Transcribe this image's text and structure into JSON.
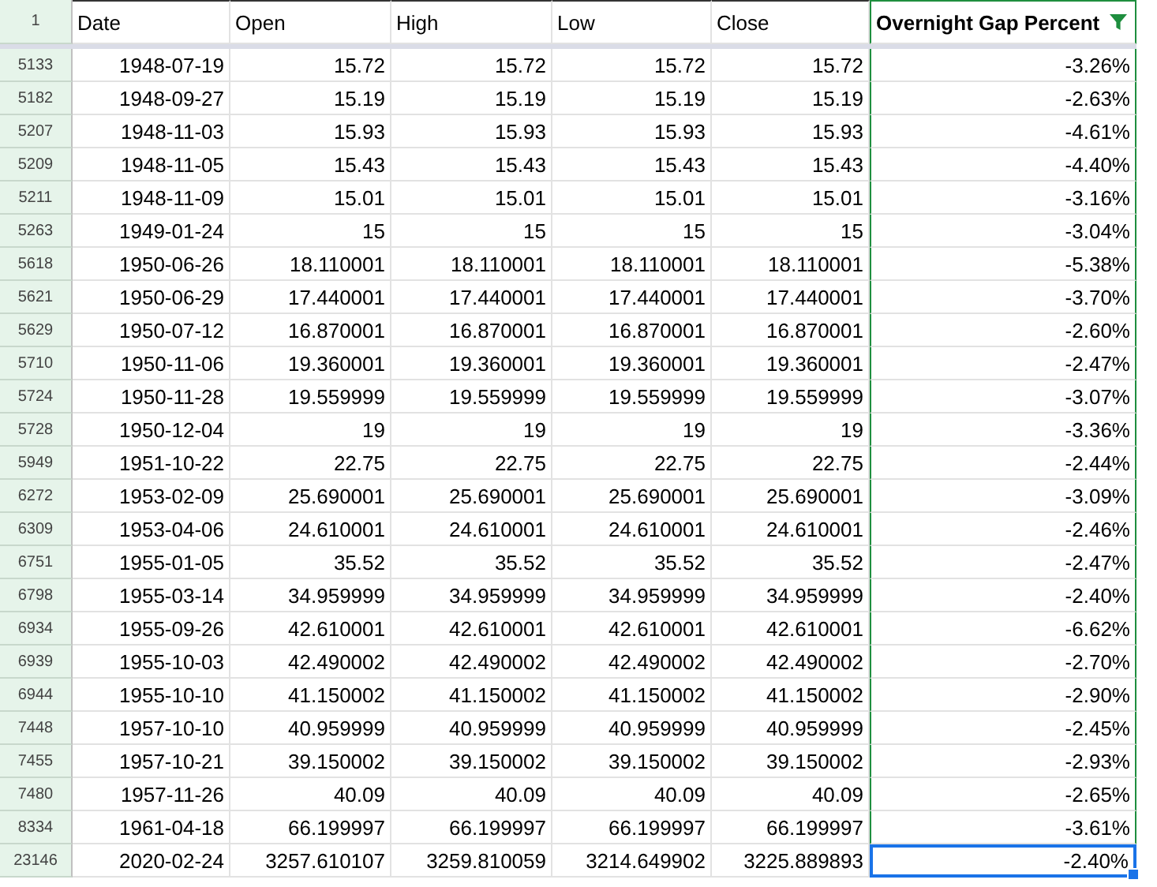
{
  "corner": "1",
  "columns": [
    {
      "label": "Date",
      "filtered": false
    },
    {
      "label": "Open",
      "filtered": false
    },
    {
      "label": "High",
      "filtered": false
    },
    {
      "label": "Low",
      "filtered": false
    },
    {
      "label": "Close",
      "filtered": false
    },
    {
      "label": "Overnight Gap Percent",
      "filtered": true
    }
  ],
  "rows": [
    {
      "number": "5133",
      "cells": [
        "1948-07-19",
        "15.72",
        "15.72",
        "15.72",
        "15.72",
        "-3.26%"
      ],
      "selected": false
    },
    {
      "number": "5182",
      "cells": [
        "1948-09-27",
        "15.19",
        "15.19",
        "15.19",
        "15.19",
        "-2.63%"
      ],
      "selected": false
    },
    {
      "number": "5207",
      "cells": [
        "1948-11-03",
        "15.93",
        "15.93",
        "15.93",
        "15.93",
        "-4.61%"
      ],
      "selected": false
    },
    {
      "number": "5209",
      "cells": [
        "1948-11-05",
        "15.43",
        "15.43",
        "15.43",
        "15.43",
        "-4.40%"
      ],
      "selected": false
    },
    {
      "number": "5211",
      "cells": [
        "1948-11-09",
        "15.01",
        "15.01",
        "15.01",
        "15.01",
        "-3.16%"
      ],
      "selected": false
    },
    {
      "number": "5263",
      "cells": [
        "1949-01-24",
        "15",
        "15",
        "15",
        "15",
        "-3.04%"
      ],
      "selected": false
    },
    {
      "number": "5618",
      "cells": [
        "1950-06-26",
        "18.110001",
        "18.110001",
        "18.110001",
        "18.110001",
        "-5.38%"
      ],
      "selected": false
    },
    {
      "number": "5621",
      "cells": [
        "1950-06-29",
        "17.440001",
        "17.440001",
        "17.440001",
        "17.440001",
        "-3.70%"
      ],
      "selected": false
    },
    {
      "number": "5629",
      "cells": [
        "1950-07-12",
        "16.870001",
        "16.870001",
        "16.870001",
        "16.870001",
        "-2.60%"
      ],
      "selected": false
    },
    {
      "number": "5710",
      "cells": [
        "1950-11-06",
        "19.360001",
        "19.360001",
        "19.360001",
        "19.360001",
        "-2.47%"
      ],
      "selected": false
    },
    {
      "number": "5724",
      "cells": [
        "1950-11-28",
        "19.559999",
        "19.559999",
        "19.559999",
        "19.559999",
        "-3.07%"
      ],
      "selected": false
    },
    {
      "number": "5728",
      "cells": [
        "1950-12-04",
        "19",
        "19",
        "19",
        "19",
        "-3.36%"
      ],
      "selected": false
    },
    {
      "number": "5949",
      "cells": [
        "1951-10-22",
        "22.75",
        "22.75",
        "22.75",
        "22.75",
        "-2.44%"
      ],
      "selected": false
    },
    {
      "number": "6272",
      "cells": [
        "1953-02-09",
        "25.690001",
        "25.690001",
        "25.690001",
        "25.690001",
        "-3.09%"
      ],
      "selected": false
    },
    {
      "number": "6309",
      "cells": [
        "1953-04-06",
        "24.610001",
        "24.610001",
        "24.610001",
        "24.610001",
        "-2.46%"
      ],
      "selected": false
    },
    {
      "number": "6751",
      "cells": [
        "1955-01-05",
        "35.52",
        "35.52",
        "35.52",
        "35.52",
        "-2.47%"
      ],
      "selected": false
    },
    {
      "number": "6798",
      "cells": [
        "1955-03-14",
        "34.959999",
        "34.959999",
        "34.959999",
        "34.959999",
        "-2.40%"
      ],
      "selected": false
    },
    {
      "number": "6934",
      "cells": [
        "1955-09-26",
        "42.610001",
        "42.610001",
        "42.610001",
        "42.610001",
        "-6.62%"
      ],
      "selected": false
    },
    {
      "number": "6939",
      "cells": [
        "1955-10-03",
        "42.490002",
        "42.490002",
        "42.490002",
        "42.490002",
        "-2.70%"
      ],
      "selected": false
    },
    {
      "number": "6944",
      "cells": [
        "1955-10-10",
        "41.150002",
        "41.150002",
        "41.150002",
        "41.150002",
        "-2.90%"
      ],
      "selected": false
    },
    {
      "number": "7448",
      "cells": [
        "1957-10-10",
        "40.959999",
        "40.959999",
        "40.959999",
        "40.959999",
        "-2.45%"
      ],
      "selected": false
    },
    {
      "number": "7455",
      "cells": [
        "1957-10-21",
        "39.150002",
        "39.150002",
        "39.150002",
        "39.150002",
        "-2.93%"
      ],
      "selected": false
    },
    {
      "number": "7480",
      "cells": [
        "1957-11-26",
        "40.09",
        "40.09",
        "40.09",
        "40.09",
        "-2.65%"
      ],
      "selected": false
    },
    {
      "number": "8334",
      "cells": [
        "1961-04-18",
        "66.199997",
        "66.199997",
        "66.199997",
        "66.199997",
        "-3.61%"
      ],
      "selected": false
    },
    {
      "number": "23146",
      "cells": [
        "2020-02-24",
        "3257.610107",
        "3259.810059",
        "3214.649902",
        "3225.889893",
        "-2.40%"
      ],
      "selected": true
    }
  ]
}
